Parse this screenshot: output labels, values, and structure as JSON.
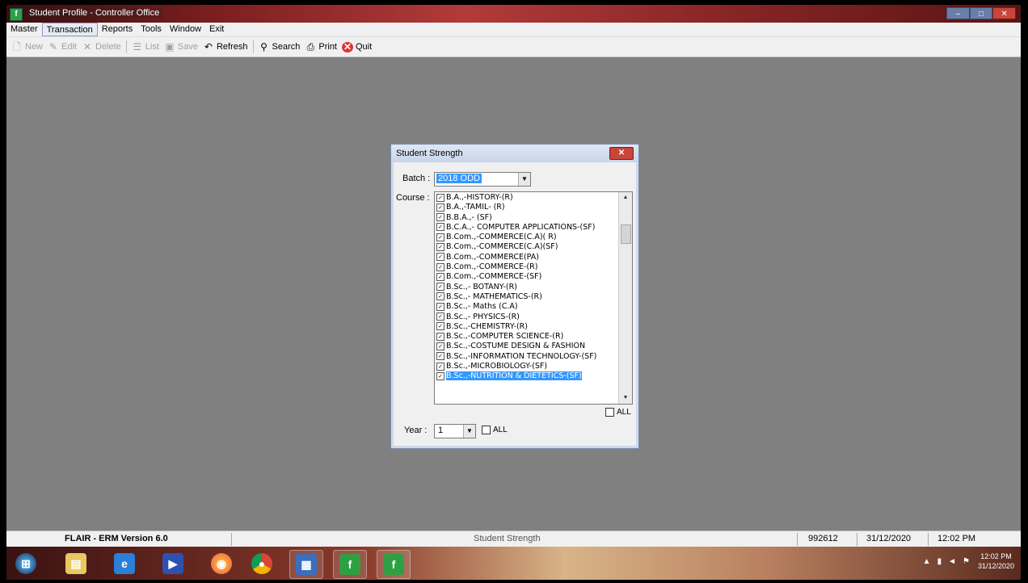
{
  "window": {
    "title": "Student Profile - Controller Office"
  },
  "menu": [
    {
      "label": "Master",
      "active": false
    },
    {
      "label": "Transaction",
      "active": true
    },
    {
      "label": "Reports",
      "active": false
    },
    {
      "label": "Tools",
      "active": false
    },
    {
      "label": "Window",
      "active": false
    },
    {
      "label": "Exit",
      "active": false
    }
  ],
  "toolbar": {
    "new": "New",
    "edit": "Edit",
    "delete": "Delete",
    "list": "List",
    "save": "Save",
    "refresh": "Refresh",
    "search": "Search",
    "print": "Print",
    "quit": "Quit"
  },
  "dialog": {
    "title": "Student Strength",
    "batch_label": "Batch :",
    "batch_value": "2018 ODD",
    "course_label": "Course :",
    "courses": [
      "B.A.,-HISTORY-(R)",
      "B.A.,-TAMIL- (R)",
      "B.B.A.,- (SF)",
      "B.C.A.,- COMPUTER APPLICATIONS-(SF)",
      "B.Com.,-COMMERCE(C.A)( R)",
      "B.Com.,-COMMERCE(C.A)(SF)",
      "B.Com.,-COMMERCE(PA)",
      "B.Com.,-COMMERCE-(R)",
      "B.Com.,-COMMERCE-(SF)",
      "B.Sc.,- BOTANY-(R)",
      "B.Sc.,- MATHEMATICS-(R)",
      "B.Sc.,- Maths (C.A)",
      "B.Sc.,- PHYSICS-(R)",
      "B.Sc.,-CHEMISTRY-(R)",
      "B.Sc.,-COMPUTER SCIENCE-(R)",
      "B.Sc.,-COSTUME DESIGN & FASHION",
      "B.Sc.,-INFORMATION TECHNOLOGY-(SF)",
      "B.Sc.,-MICROBIOLOGY-(SF)",
      "B.Sc.,-NUTRITION & DIETETICS-(SF)"
    ],
    "course_all_label": "ALL",
    "year_label": "Year :",
    "year_value": "1",
    "year_all_label": "ALL"
  },
  "statusbar": {
    "version": "FLAIR - ERM Version 6.0",
    "form": "Student Strength",
    "user": "992612",
    "date": "31/12/2020",
    "time": "12:02 PM"
  },
  "taskbar": {
    "clock_time": "12:02 PM",
    "clock_date": "31/12/2020"
  }
}
